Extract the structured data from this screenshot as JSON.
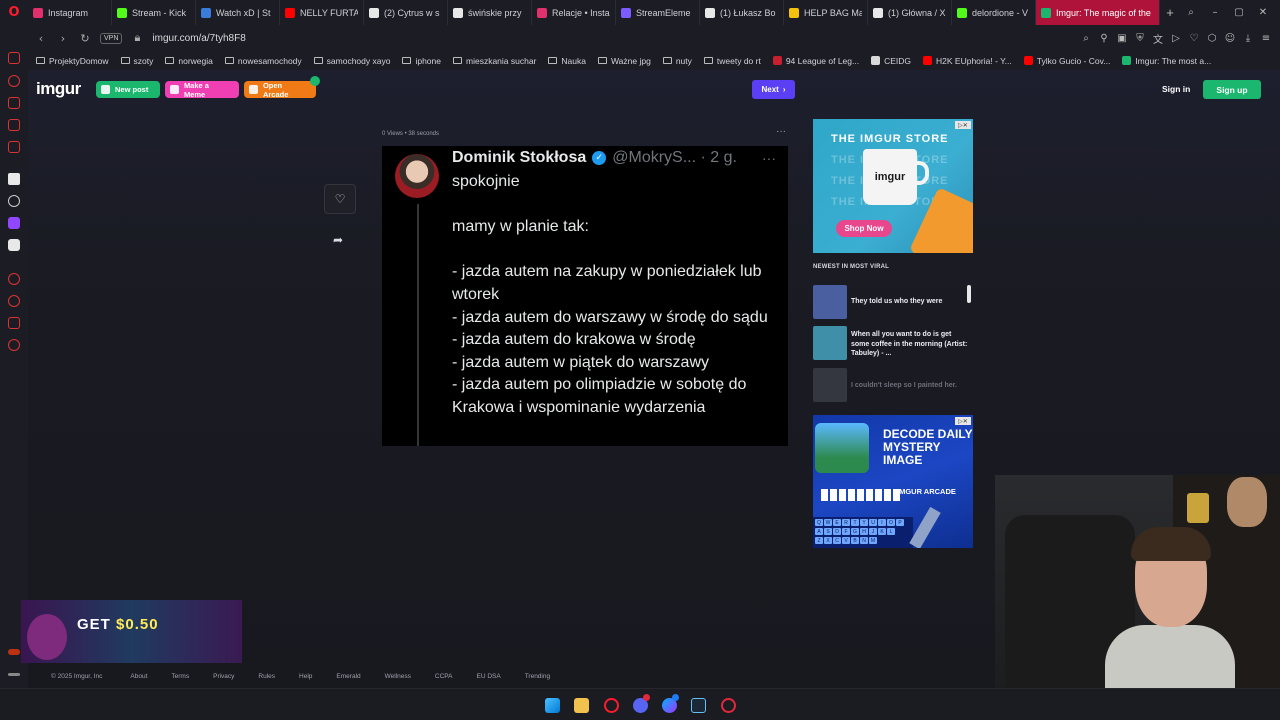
{
  "browser": {
    "tabs": [
      {
        "label": "Instagram",
        "color": "#e1306c"
      },
      {
        "label": "Stream - Kick",
        "color": "#53fc18"
      },
      {
        "label": "Watch xD | St",
        "color": "#3b7bd9"
      },
      {
        "label": "NELLY FURTA",
        "color": "#ff0000"
      },
      {
        "label": "(2) Cytrus w s",
        "color": "#e8e8e8"
      },
      {
        "label": "świńskie przy",
        "color": "#e8e8e8"
      },
      {
        "label": "Relacje • Insta",
        "color": "#e1306c"
      },
      {
        "label": "StreamEleme",
        "color": "#7b5cff"
      },
      {
        "label": "(1) Łukasz Bo",
        "color": "#e8e8e8"
      },
      {
        "label": "HELP BAG Ma",
        "color": "#f4c20d"
      },
      {
        "label": "(1) Główna / X",
        "color": "#e8e8e8"
      },
      {
        "label": "delordione - V",
        "color": "#53fc18"
      },
      {
        "label": "Imgur: The magic of the",
        "color": "#1bb76e",
        "active": true
      }
    ],
    "new_tab": "+",
    "vpn_label": "VPN",
    "url": "imgur.com/a/7tyh8F8",
    "bookmarks": [
      {
        "label": "ProjektyDomow",
        "type": "folder"
      },
      {
        "label": "szoty",
        "type": "folder"
      },
      {
        "label": "norwegia",
        "type": "folder"
      },
      {
        "label": "nowesamochody",
        "type": "folder"
      },
      {
        "label": "samochody xayo",
        "type": "folder"
      },
      {
        "label": "iphone",
        "type": "folder"
      },
      {
        "label": "mieszkania suchar",
        "type": "folder"
      },
      {
        "label": "Nauka",
        "type": "folder"
      },
      {
        "label": "Ważne jpg",
        "type": "folder"
      },
      {
        "label": "nuty",
        "type": "folder"
      },
      {
        "label": "tweety do rt",
        "type": "folder"
      },
      {
        "label": "94 League of Leg...",
        "type": "site",
        "color": "#c8202f"
      },
      {
        "label": "CEIDG",
        "type": "site",
        "color": "#d9d9d9"
      },
      {
        "label": "H2K EUphoria! - Y...",
        "type": "site",
        "color": "#ff0000"
      },
      {
        "label": "Tylko Gucio - Cov...",
        "type": "site",
        "color": "#ff0000"
      },
      {
        "label": "Imgur: The most a...",
        "type": "site",
        "color": "#1bb76e"
      }
    ]
  },
  "imgur": {
    "logo": "imgur",
    "new_post": "New post",
    "make_meme": "Make a Meme",
    "open_arcade": "Open Arcade",
    "next": "Next",
    "sign_in": "Sign in",
    "sign_up": "Sign up",
    "post_meta": "0 Views • 38 seconds",
    "options": "···"
  },
  "tweet": {
    "name": "Dominik Stokłosa",
    "handle": "@MokryS... · 2 g.",
    "body": "spokojnie\n\nmamy w planie tak:\n\n- jazda autem na zakupy w poniedziałek lub wtorek\n- jazda autem do warszawy w środę do sądu\n- jazda autem do krakowa w środę\n- jazda autem w piątek do warszawy\n- jazda autem po olimpiadzie w sobotę do Krakowa i wspominanie wydarzenia"
  },
  "store_ad": {
    "title": "THE IMGUR STORE",
    "mug_text": "imgur",
    "button": "Shop Now"
  },
  "viral": {
    "title": "NEWEST IN MOST VIRAL",
    "items": [
      {
        "title": "They told us who they were",
        "thumb": "#4a5fa0"
      },
      {
        "title": "When all you want to do is get some coffee in the morning (Artist: Tabuley) - ...",
        "thumb": "#3f8fa8"
      },
      {
        "title": "I couldn't sleep so I painted her.",
        "thumb": "#555a66"
      }
    ]
  },
  "arcade_ad": {
    "title": "DECODE DAILY MYSTERY IMAGE",
    "subtitle": "IMGUR ARCADE",
    "keys_row1": [
      "Q",
      "W",
      "E",
      "R",
      "T",
      "Y",
      "U",
      "I",
      "O",
      "P"
    ],
    "keys_row2": [
      "A",
      "S",
      "D",
      "F",
      "G",
      "H",
      "J",
      "K",
      "L"
    ],
    "keys_row3": [
      "Z",
      "X",
      "C",
      "V",
      "B",
      "N",
      "M"
    ]
  },
  "footer": {
    "copyright": "© 2025 Imgur, Inc",
    "links": [
      "About",
      "Terms",
      "Privacy",
      "Rules",
      "Help",
      "Emerald",
      "Wellness",
      "CCPA",
      "EU DSA",
      "Trending"
    ]
  },
  "promo": {
    "prefix": "GET",
    "amount": "$0.50"
  }
}
